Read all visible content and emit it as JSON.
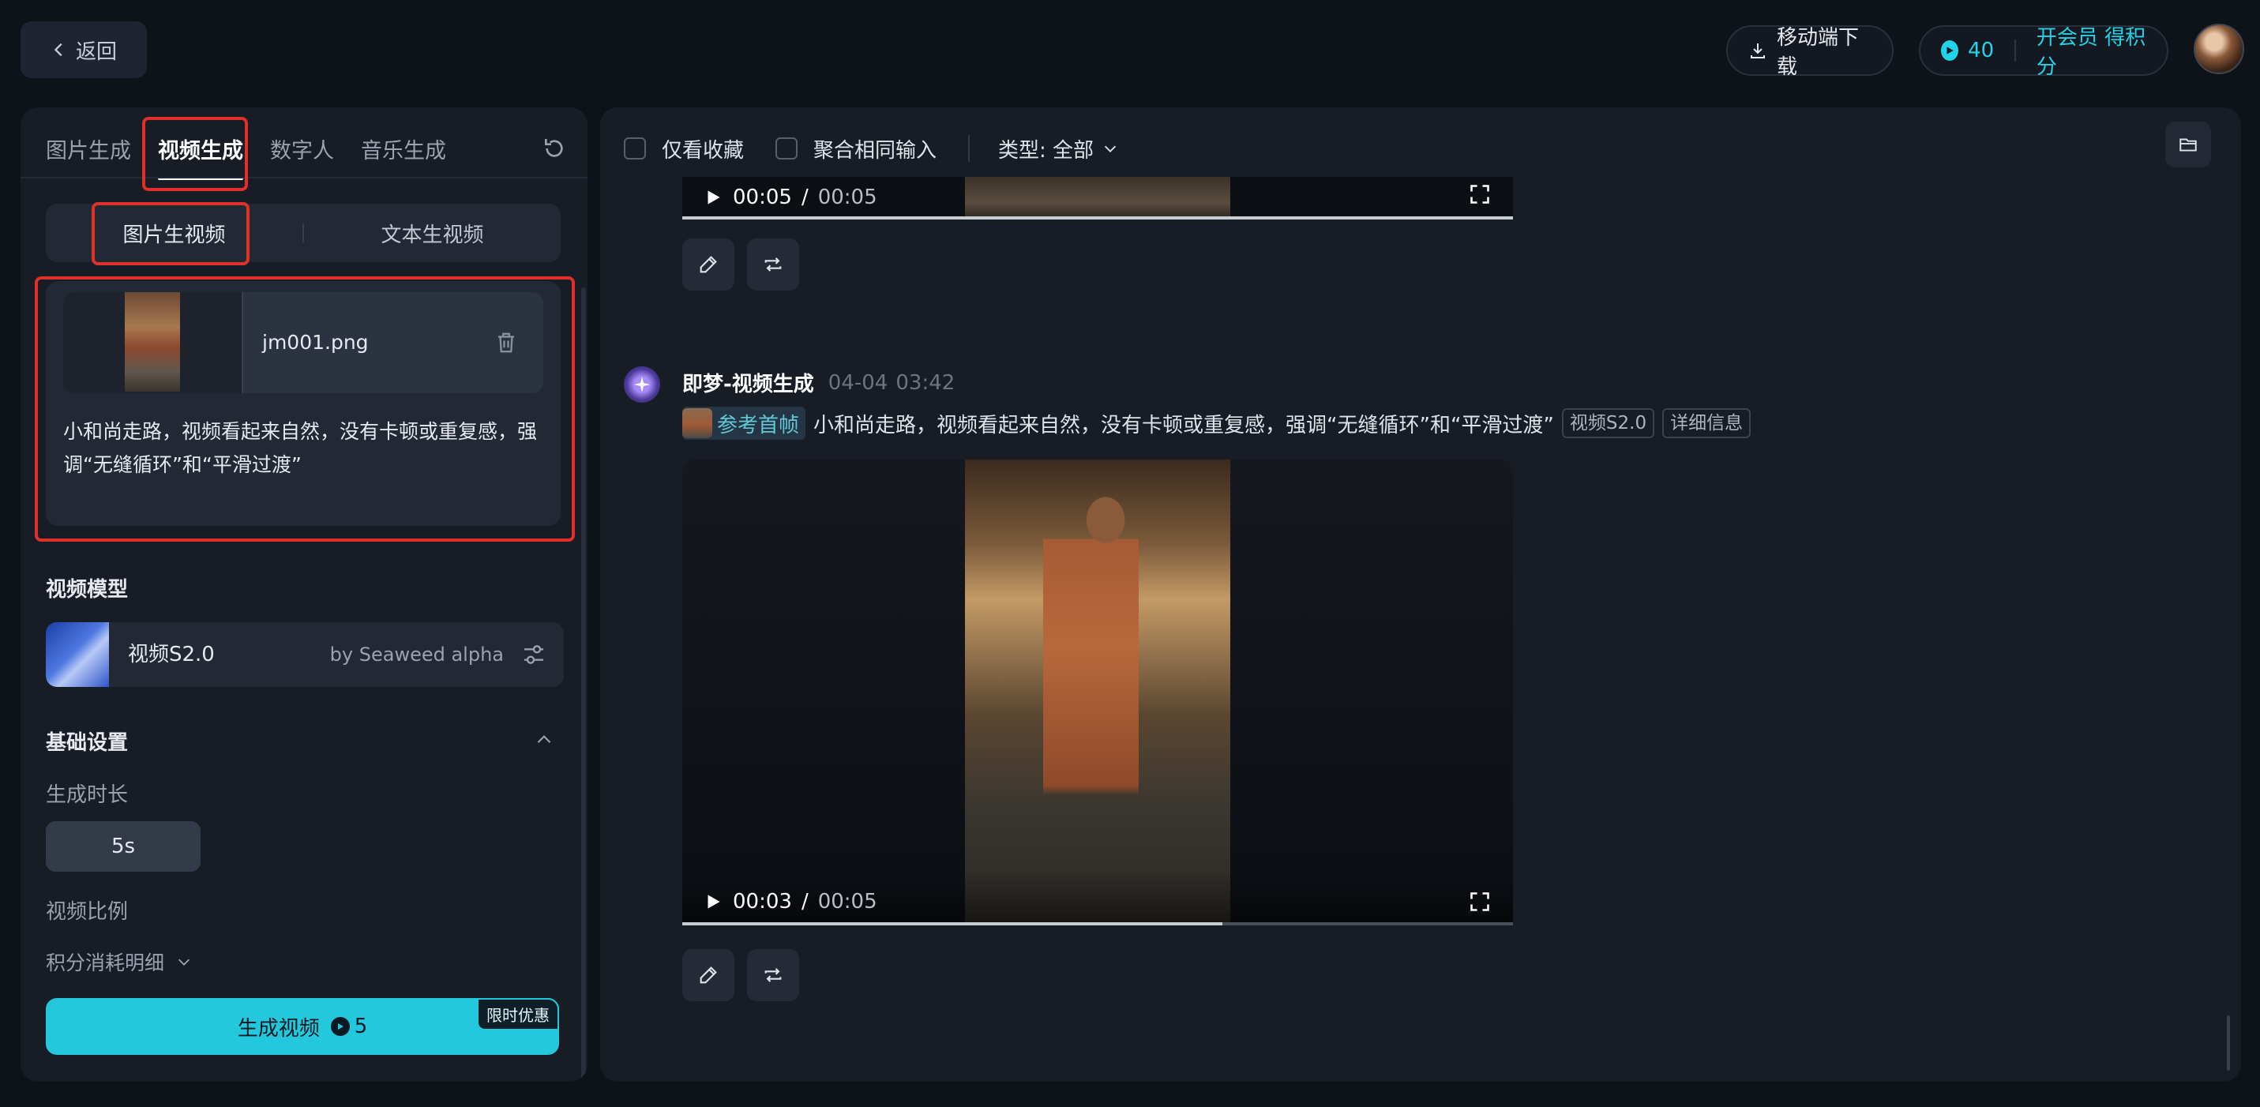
{
  "topbar": {
    "back_label": "返回",
    "download_label": "移动端下载",
    "points": "40",
    "vip_label": "开会员 得积分"
  },
  "left": {
    "tabs": [
      "图片生成",
      "视频生成",
      "数字人",
      "音乐生成"
    ],
    "subtabs": [
      "图片生视频",
      "文本生视频"
    ],
    "file_name": "jm001.png",
    "prompt": "小和尚走路，视频看起来自然，没有卡顿或重复感，强调“无缝循环”和“平滑过渡”",
    "model_section": "视频模型",
    "model_name": "视频S2.0",
    "model_by": "by Seaweed alpha",
    "basic_settings": "基础设置",
    "duration_label": "生成时长",
    "duration_value": "5s",
    "ratio_label": "视频比例",
    "cost_detail": "积分消耗明细",
    "generate_label": "生成视频",
    "generate_cost": "5",
    "promo": "限时优惠"
  },
  "right": {
    "filter_fav": "仅看收藏",
    "filter_merge": "聚合相同输入",
    "type_select": "类型: 全部",
    "video1": {
      "current": "00:05",
      "total": "00:05",
      "progress": 1.0
    },
    "message": {
      "sender": "即梦-视频生成",
      "date": "04-04",
      "time": "03:42",
      "ref_label": "参考首帧",
      "prompt": "小和尚走路，视频看起来自然，没有卡顿或重复感，强调“无缝循环”和“平滑过渡”",
      "model_tag": "视频S2.0",
      "detail_tag": "详细信息"
    },
    "video2": {
      "current": "00:03",
      "total": "00:05",
      "progress": 0.65
    }
  },
  "colors": {
    "accent": "#23c8dc",
    "highlight": "#e0302a",
    "background": "#0e1219"
  }
}
